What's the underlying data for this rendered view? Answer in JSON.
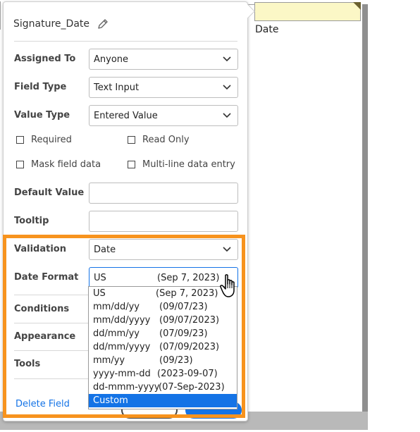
{
  "field": {
    "name": "Signature_Date",
    "doc_label": "Date"
  },
  "form": {
    "assigned_to": {
      "label": "Assigned To",
      "value": "Anyone"
    },
    "field_type": {
      "label": "Field Type",
      "value": "Text Input"
    },
    "value_type": {
      "label": "Value Type",
      "value": "Entered Value"
    },
    "checkboxes": {
      "required": "Required",
      "read_only": "Read Only",
      "mask": "Mask field data",
      "multiline": "Multi-line data entry"
    },
    "default_value": {
      "label": "Default Value",
      "value": ""
    },
    "tooltip": {
      "label": "Tooltip",
      "value": ""
    },
    "validation": {
      "label": "Validation",
      "value": "Date"
    },
    "date_format": {
      "label": "Date Format",
      "value": "US",
      "example": "(Sep 7, 2023)"
    }
  },
  "sections": {
    "conditions": "Conditions",
    "appearance": "Appearance",
    "tools": "Tools"
  },
  "delete_label": "Delete Field",
  "date_format_options": [
    {
      "name": "US",
      "example": "(Sep 7, 2023)"
    },
    {
      "name": "mm/dd/yy",
      "example": "(09/07/23)"
    },
    {
      "name": "mm/dd/yyyy",
      "example": "(09/07/2023)"
    },
    {
      "name": "dd/mm/yy",
      "example": "(07/09/23)"
    },
    {
      "name": "dd/mm/yyyy",
      "example": "(07/09/2023)"
    },
    {
      "name": "mm/yy",
      "example": "(09/23)"
    },
    {
      "name": "yyyy-mm-dd",
      "example": "(2023-09-07)"
    },
    {
      "name": "dd-mmm-yyyy",
      "example": "(07-Sep-2023)"
    },
    {
      "name": "Custom",
      "example": ""
    }
  ],
  "selected_option": "Custom",
  "colors": {
    "accent": "#1473e6",
    "highlight_frame": "#f7931e",
    "field_fill": "#fbf7c6"
  },
  "icons": [
    "pencil-icon",
    "chevron-down-icon",
    "hand-cursor-icon",
    "checkbox-icon"
  ]
}
